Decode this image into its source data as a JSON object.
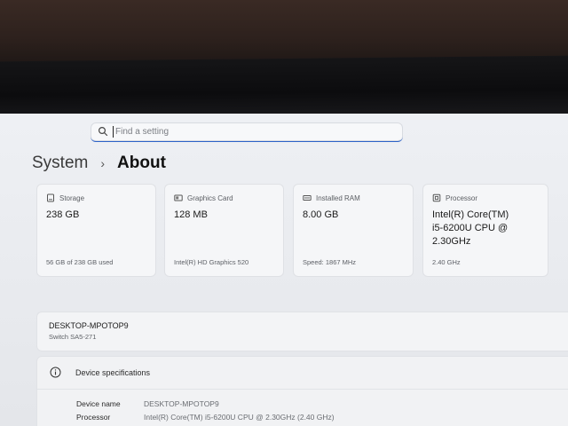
{
  "search": {
    "placeholder": "Find a setting"
  },
  "breadcrumb": {
    "parent": "System",
    "separator": "›",
    "current": "About"
  },
  "cards": [
    {
      "icon": "storage-icon",
      "label": "Storage",
      "value": "238 GB",
      "sub": "56 GB of 238 GB used"
    },
    {
      "icon": "graphics-card-icon",
      "label": "Graphics Card",
      "value": "128 MB",
      "sub": "Intel(R) HD Graphics 520"
    },
    {
      "icon": "ram-icon",
      "label": "Installed RAM",
      "value": "8.00 GB",
      "sub": "Speed: 1867 MHz"
    },
    {
      "icon": "processor-icon",
      "label": "Processor",
      "value": "Intel(R) Core(TM) i5-6200U CPU @ 2.30GHz",
      "sub": "2.40 GHz"
    }
  ],
  "device": {
    "name": "DESKTOP-MPOTOP9",
    "model": "Switch SA5-271"
  },
  "specs": {
    "icon": "info-icon",
    "title": "Device specifications",
    "rows": [
      {
        "label": "Device name",
        "value": "DESKTOP-MPOTOP9"
      },
      {
        "label": "Processor",
        "value": "Intel(R) Core(TM) i5-6200U CPU @ 2.30GHz (2.40 GHz)"
      }
    ]
  },
  "colors": {
    "accent": "#2d63c9",
    "background": "#eceef2",
    "card": "#f5f6f8"
  }
}
